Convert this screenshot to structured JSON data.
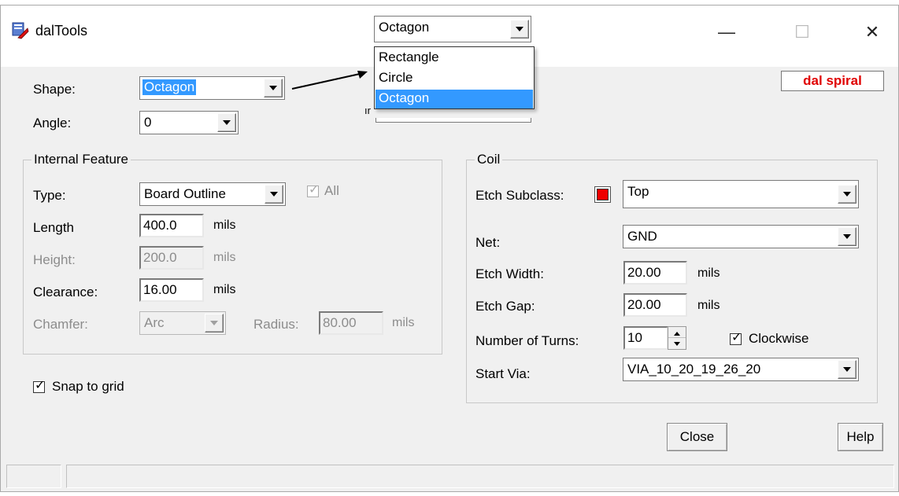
{
  "window": {
    "title": "dalTools",
    "badge": "dal spiral",
    "controls": {
      "minimize": "—",
      "maximize": "☐",
      "close": "✕"
    }
  },
  "shape": {
    "label": "Shape:",
    "value": "Octagon"
  },
  "angle": {
    "label": "Angle:",
    "value": "0"
  },
  "internal_feature": {
    "title": "Internal Feature",
    "type": {
      "label": "Type:",
      "value": "Board Outline"
    },
    "all": {
      "label": "All",
      "checked": true
    },
    "length": {
      "label": "Length",
      "value": "400.0",
      "unit": "mils"
    },
    "height": {
      "label": "Height:",
      "value": "200.0",
      "unit": "mils"
    },
    "clearance": {
      "label": "Clearance:",
      "value": "16.00",
      "unit": "mils"
    },
    "chamfer": {
      "label": "Chamfer:",
      "value": "Arc"
    },
    "radius": {
      "label": "Radius:",
      "value": "80.00",
      "unit": "mils"
    }
  },
  "snap_to_grid": {
    "label": "Snap to grid",
    "checked": true
  },
  "coil": {
    "title": "Coil",
    "etch_subclass": {
      "label": "Etch Subclass:",
      "value": "Top",
      "swatch_color": "#ee0000"
    },
    "net": {
      "label": "Net:",
      "value": "GND"
    },
    "etch_width": {
      "label": "Etch Width:",
      "value": "20.00",
      "unit": "mils"
    },
    "etch_gap": {
      "label": "Etch Gap:",
      "value": "20.00",
      "unit": "mils"
    },
    "turns": {
      "label": "Number of Turns:",
      "value": "10"
    },
    "clockwise": {
      "label": "Clockwise",
      "checked": true
    },
    "start_via": {
      "label": "Start Via:",
      "value": "VIA_10_20_19_26_20"
    }
  },
  "buttons": {
    "close": "Close",
    "help": "Help"
  },
  "popup": {
    "value": "Octagon",
    "options": [
      "Rectangle",
      "Circle",
      "Octagon"
    ],
    "selected": "Octagon"
  },
  "colors": {
    "selection": "#3399ff",
    "badge_text": "#e00000"
  }
}
